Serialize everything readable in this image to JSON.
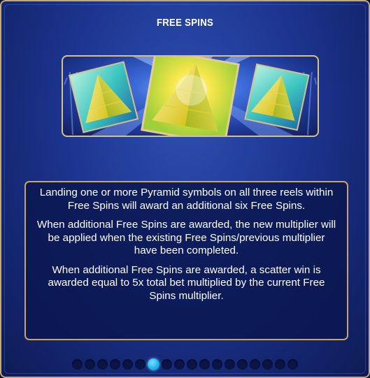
{
  "title": "FREE SPINS",
  "illustration": {
    "icon": "pyramid-symbols-icon",
    "description_hidden": ""
  },
  "paragraphs": [
    "Landing one or more Pyramid symbols on all three reels within Free Spins will award an additional six Free Spins.",
    "When additional Free Spins are awarded, the new multiplier will be applied when the existing Free Spins/previous multiplier have been completed.",
    "When additional Free Spins are awarded, a scatter win is awarded equal to 5x total bet multiplied by the current Free Spins multiplier."
  ],
  "pager": {
    "total_pages": 18,
    "current_page": 7
  },
  "colors": {
    "accent_gold": "#c8a468",
    "active_dot": "#22b4f0",
    "panel_blue": "#1d3590"
  }
}
